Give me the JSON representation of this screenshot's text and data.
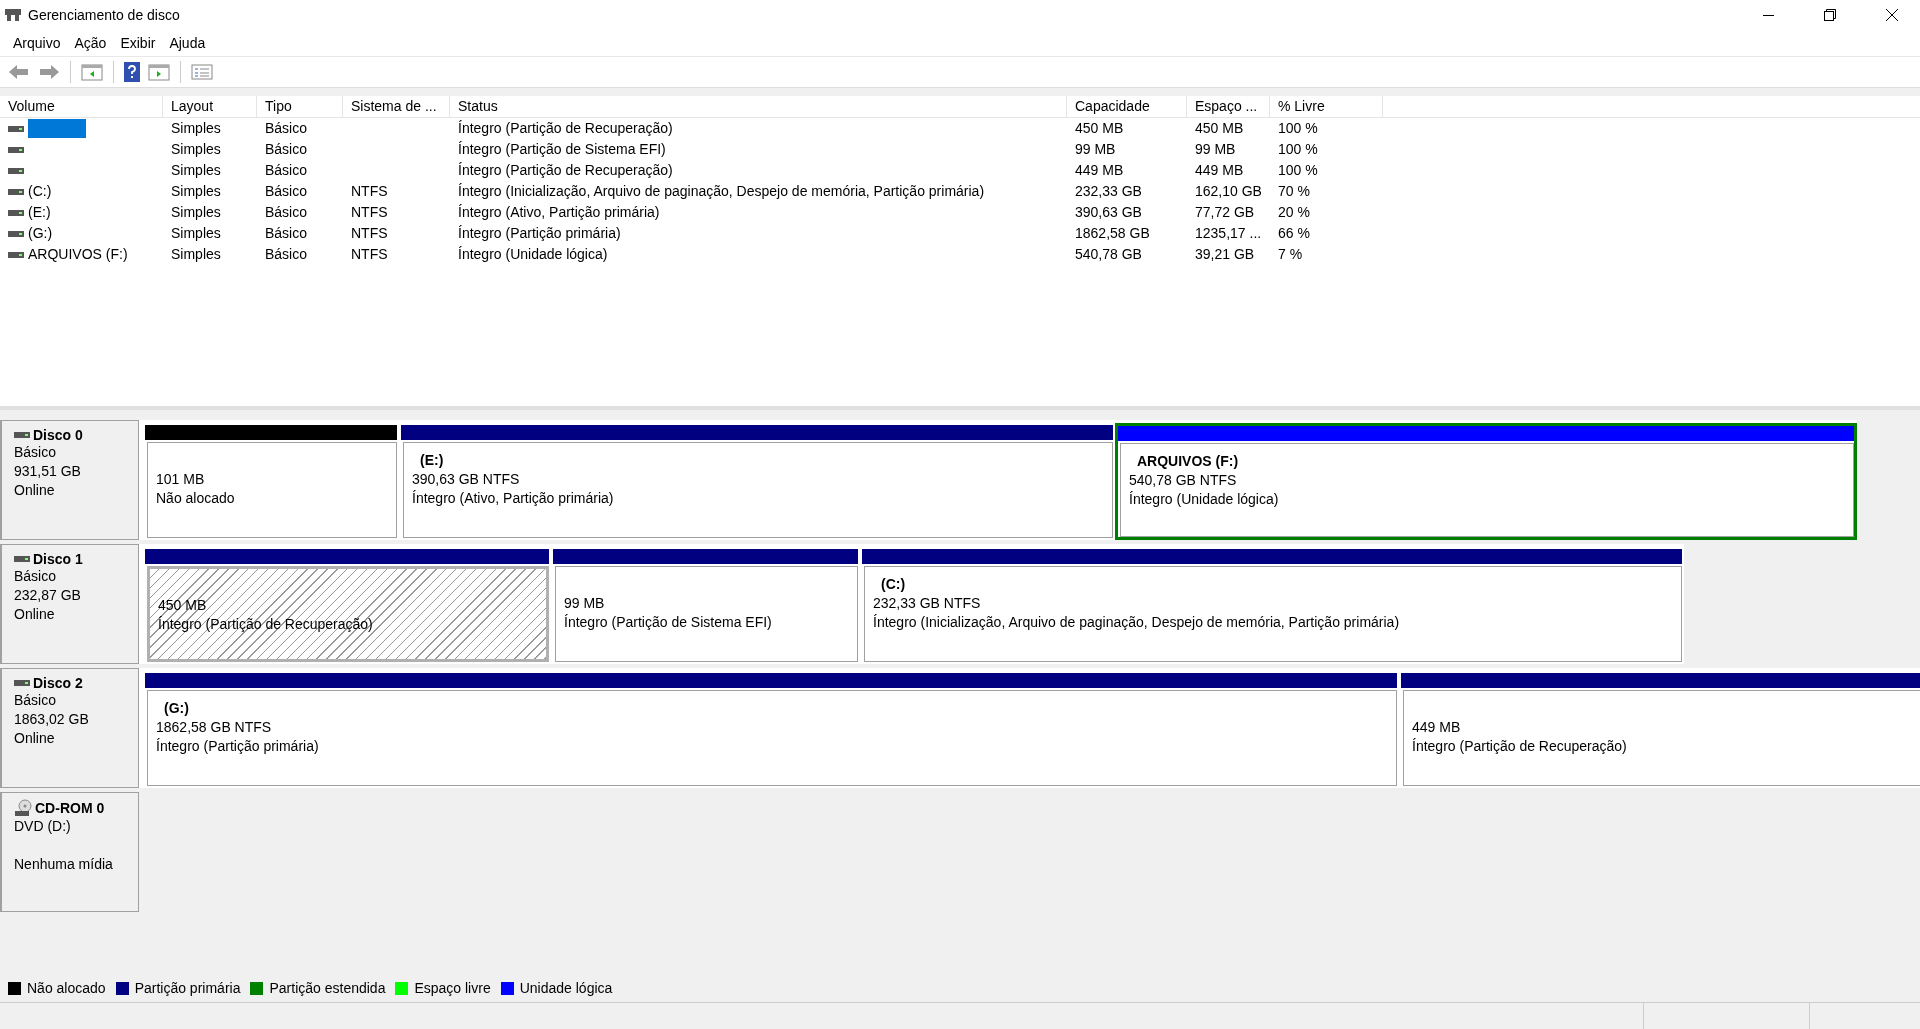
{
  "window": {
    "title": "Gerenciamento de disco"
  },
  "menu": [
    "Arquivo",
    "Ação",
    "Exibir",
    "Ajuda"
  ],
  "table": {
    "columns": [
      "Volume",
      "Layout",
      "Tipo",
      "Sistema de ...",
      "Status",
      "Capacidade",
      "Espaço ...",
      "% Livre"
    ],
    "rows": [
      {
        "selected": true,
        "layout": "Simples",
        "type": "Básico",
        "status": "Íntegro (Partição de Recuperação)",
        "capacity": "450 MB",
        "free": "450 MB",
        "pct": "100 %"
      },
      {
        "selected": false,
        "layout": "Simples",
        "type": "Básico",
        "status": "Íntegro (Partição de Sistema EFI)",
        "capacity": "99 MB",
        "free": "99 MB",
        "pct": "100 %"
      },
      {
        "selected": false,
        "layout": "Simples",
        "type": "Básico",
        "status": "Íntegro (Partição de Recuperação)",
        "capacity": "449 MB",
        "free": "449 MB",
        "pct": "100 %"
      },
      {
        "selected": false,
        "volume": "(C:)",
        "layout": "Simples",
        "type": "Básico",
        "fs": "NTFS",
        "status": "Íntegro (Inicialização, Arquivo de paginação, Despejo de memória, Partição primária)",
        "capacity": "232,33 GB",
        "free": "162,10 GB",
        "pct": "70 %"
      },
      {
        "selected": false,
        "volume": "(E:)",
        "layout": "Simples",
        "type": "Básico",
        "fs": "NTFS",
        "status": "Íntegro (Ativo, Partição primária)",
        "capacity": "390,63 GB",
        "free": "77,72 GB",
        "pct": "20 %"
      },
      {
        "selected": false,
        "volume": "(G:)",
        "layout": "Simples",
        "type": "Básico",
        "fs": "NTFS",
        "status": "Íntegro (Partição primária)",
        "capacity": "1862,58 GB",
        "free": "1235,17 ...",
        "pct": "66 %"
      },
      {
        "selected": false,
        "volume": "ARQUIVOS (F:)",
        "layout": "Simples",
        "type": "Básico",
        "fs": "NTFS",
        "status": "Íntegro (Unidade lógica)",
        "capacity": "540,78 GB",
        "free": "39,21 GB",
        "pct": "7 %"
      }
    ]
  },
  "disks": [
    {
      "kind": "disk",
      "name": "Disco 0",
      "type": "Básico",
      "size": "931,51 GB",
      "status": "Online",
      "partitions": [
        {
          "kind": "unallocated",
          "selected": false,
          "size": "101 MB",
          "status": "Não alocado"
        },
        {
          "kind": "primary",
          "selected": false,
          "label": "(E:)",
          "size": "390,63 GB NTFS",
          "status": "Íntegro (Ativo, Partição primária)"
        },
        {
          "kind": "logical",
          "selected": false,
          "label": "ARQUIVOS  (F:)",
          "size": "540,78 GB NTFS",
          "status": "Íntegro (Unidade lógica)"
        }
      ]
    },
    {
      "kind": "disk",
      "name": "Disco 1",
      "type": "Básico",
      "size": "232,87 GB",
      "status": "Online",
      "partitions": [
        {
          "kind": "primary",
          "selected": true,
          "size": "450 MB",
          "status": "Íntegro (Partição de Recuperação)"
        },
        {
          "kind": "primary",
          "selected": false,
          "size": "99 MB",
          "status": "Íntegro (Partição de Sistema EFI)"
        },
        {
          "kind": "primary",
          "selected": false,
          "label": "(C:)",
          "size": "232,33 GB NTFS",
          "status": "Íntegro (Inicialização, Arquivo de paginação, Despejo de memória, Partição primária)"
        }
      ]
    },
    {
      "kind": "disk",
      "name": "Disco 2",
      "type": "Básico",
      "size": "1863,02 GB",
      "status": "Online",
      "partitions": [
        {
          "kind": "primary",
          "selected": false,
          "label": "(G:)",
          "size": "1862,58 GB NTFS",
          "status": "Íntegro (Partição primária)"
        },
        {
          "kind": "primary",
          "selected": false,
          "size": "449 MB",
          "status": "Íntegro (Partição de Recuperação)"
        }
      ]
    },
    {
      "kind": "cdrom",
      "name": "CD-ROM 0",
      "type": "DVD (D:)",
      "status": "Nenhuma mídia"
    }
  ],
  "legend": [
    {
      "label": "Não alocado",
      "color": "#000000"
    },
    {
      "label": "Partição primária",
      "color": "#000080"
    },
    {
      "label": "Partição estendida",
      "color": "#008000"
    },
    {
      "label": "Espaço livre",
      "color": "#00ff00"
    },
    {
      "label": "Unidade lógica",
      "color": "#0000ff"
    }
  ]
}
